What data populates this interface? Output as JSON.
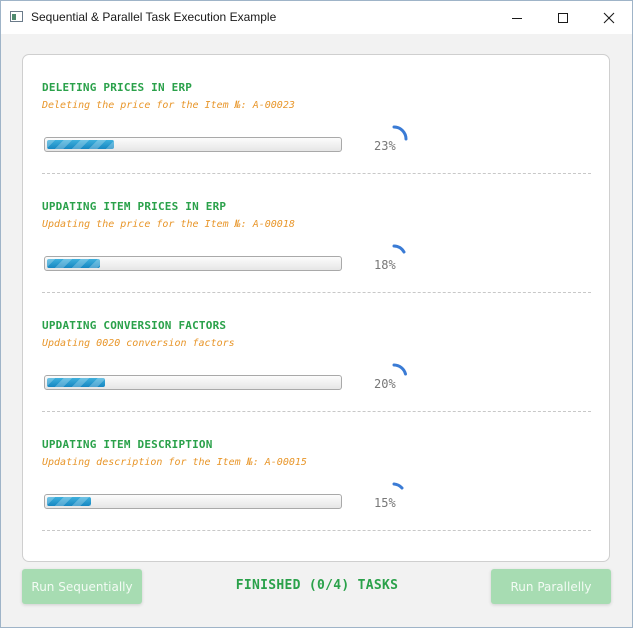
{
  "window": {
    "title": "Sequential & Parallel Task Execution Example"
  },
  "tasks": [
    {
      "title": "DELETING PRICES IN ERP",
      "message": "Deleting the price for the Item №: A-00023",
      "progress_label": "23%",
      "progress": 0.23
    },
    {
      "title": "UPDATING ITEM PRICES IN ERP",
      "message": "Updating the price for the Item №: A-00018",
      "progress_label": "18%",
      "progress": 0.18
    },
    {
      "title": "UPDATING CONVERSION FACTORS",
      "message": "Updating 0020 conversion factors",
      "progress_label": "20%",
      "progress": 0.2
    },
    {
      "title": "UPDATING ITEM DESCRIPTION",
      "message": "Updating description for the Item №: A-00015",
      "progress_label": "15%",
      "progress": 0.15
    }
  ],
  "footer": {
    "run_sequential_label": "Run Sequentially",
    "status": "FINISHED (0/4) TASKS",
    "run_parallel_label": "Run Parallelly"
  },
  "colors": {
    "task_title": "#2aa14a",
    "task_message": "#e8962a",
    "progress_fill": "#1787c2",
    "spinner": "#3a7bd5",
    "button_bg": "#a7dcb2"
  },
  "icons": {
    "app": "app-window-icon",
    "minimize": "minimize-icon",
    "maximize": "maximize-icon",
    "close": "close-icon",
    "spinner": "spinner-icon"
  }
}
